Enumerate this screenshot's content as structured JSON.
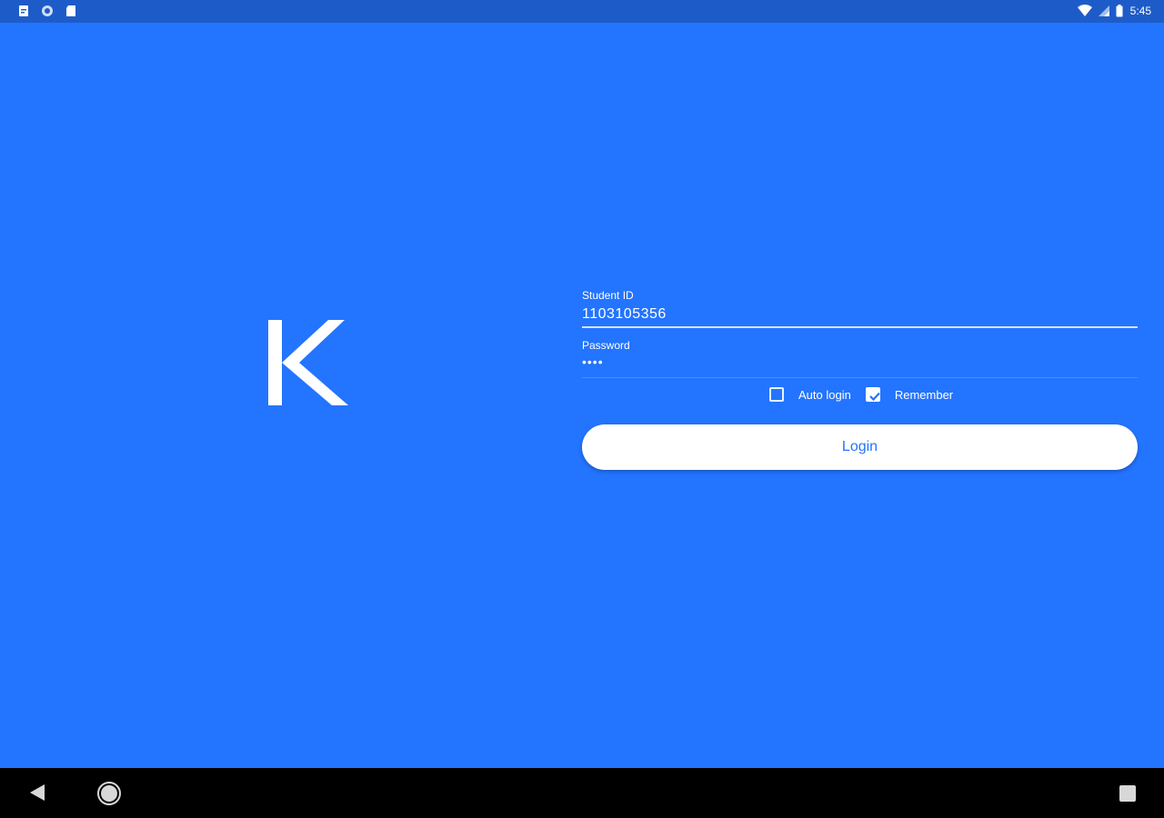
{
  "status_bar": {
    "time": "5:45",
    "left_icons": [
      "notification-doc-icon",
      "settings-circle-icon",
      "sd-card-icon"
    ],
    "right_icons": [
      "wifi-icon",
      "signal-icon",
      "battery-icon"
    ]
  },
  "logo": {
    "letter": "K"
  },
  "form": {
    "student_id_label": "Student ID",
    "student_id_value": "1103105356",
    "password_label": "Password",
    "password_value": "••••",
    "auto_login_label": "Auto login",
    "auto_login_checked": false,
    "remember_label": "Remember",
    "remember_checked": true,
    "login_button_label": "Login"
  },
  "nav_bar": {
    "back": "back-icon",
    "home": "home-icon",
    "recents": "recents-icon"
  },
  "colors": {
    "background": "#2374ff",
    "status_bar": "#1d5cc8",
    "nav_bar": "#000000",
    "button_text": "#2374ff"
  }
}
